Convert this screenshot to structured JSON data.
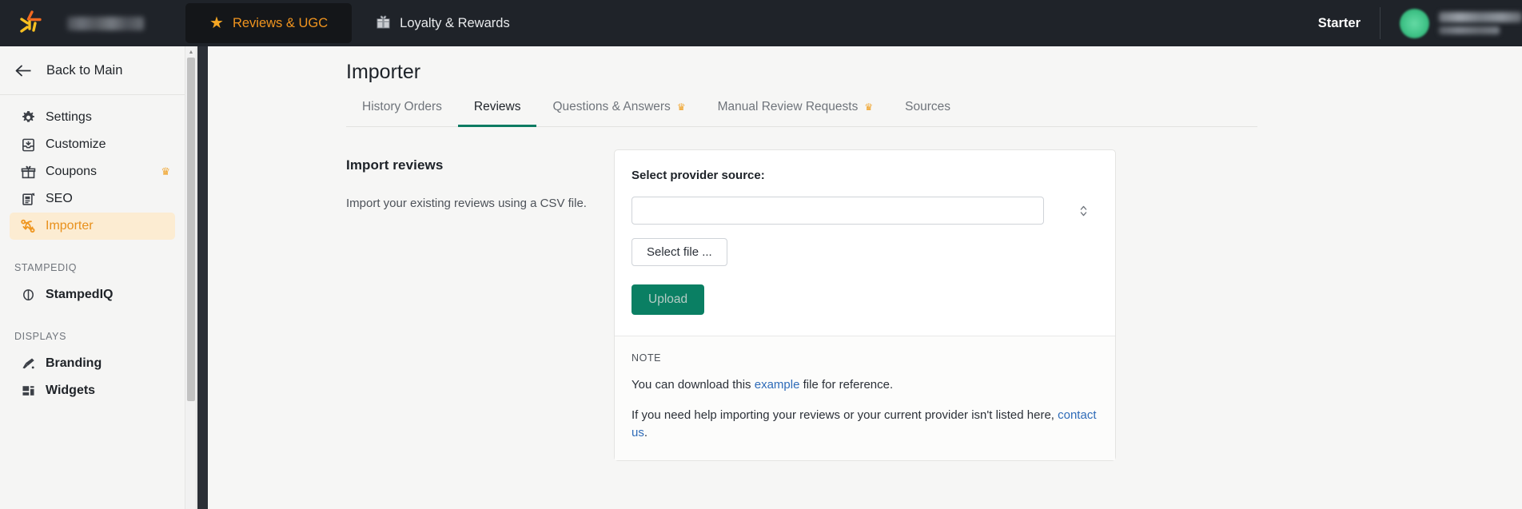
{
  "topbar": {
    "logo_icon": "starburst-logo-icon",
    "brand_name_redacted": "",
    "nav": [
      {
        "label": "Reviews & UGC",
        "icon": "star-icon",
        "icon_glyph": "★",
        "active": true
      },
      {
        "label": "Loyalty & Rewards",
        "icon": "gift-icon",
        "icon_glyph": "🎁",
        "active": false
      }
    ],
    "plan_badge": "Starter",
    "avatar_icon": "user-avatar",
    "accent_orange": "#f0941f",
    "bar_background": "#1f2329"
  },
  "sidebar": {
    "back": {
      "label": "Back to Main",
      "icon": "arrow-left-icon"
    },
    "items": [
      {
        "label": "Settings",
        "icon": "gear-icon",
        "active": false,
        "badge": ""
      },
      {
        "label": "Customize",
        "icon": "inbox-icon",
        "active": false,
        "badge": ""
      },
      {
        "label": "Coupons",
        "icon": "gift-icon",
        "active": false,
        "badge": "♛"
      },
      {
        "label": "SEO",
        "icon": "clipboard-icon",
        "active": false,
        "badge": ""
      },
      {
        "label": "Importer",
        "icon": "import-shuffle-icon",
        "active": true,
        "badge": ""
      }
    ],
    "groups": [
      {
        "title": "STAMPEDIQ",
        "items": [
          {
            "label": "StampedIQ",
            "icon": "brain-icon",
            "bold": true
          }
        ]
      },
      {
        "title": "DISPLAYS",
        "items": [
          {
            "label": "Branding",
            "icon": "paintbrush-icon",
            "bold": true
          },
          {
            "label": "Widgets",
            "icon": "widgets-layout-icon",
            "bold": true
          }
        ]
      }
    ],
    "active_background": "#fcecd2",
    "active_text": "#e8901b"
  },
  "main": {
    "page_title": "Importer",
    "tabs": [
      {
        "label": "History Orders",
        "active": false,
        "badge": ""
      },
      {
        "label": "Reviews",
        "active": true,
        "badge": ""
      },
      {
        "label": "Questions & Answers",
        "active": false,
        "badge": "♛"
      },
      {
        "label": "Manual Review Requests",
        "active": false,
        "badge": "♛"
      },
      {
        "label": "Sources",
        "active": false,
        "badge": ""
      }
    ],
    "active_tab_color": "#0c7b62",
    "left": {
      "heading": "Import reviews",
      "description": "Import your existing reviews using a CSV file."
    },
    "card": {
      "select_label": "Select provider source:",
      "select_value": "",
      "select_icon": "chevron-updown-icon",
      "select_file_label": "Select file ...",
      "upload_label": "Upload",
      "upload_color": "#0a7f63",
      "note": {
        "title": "NOTE",
        "line1_before": "You can download this ",
        "line1_link": "example",
        "line1_after": " file for reference.",
        "line2_before": "If you need help importing your reviews or your current provider isn't listed here, ",
        "line2_link": "contact us",
        "line2_after": ".",
        "link_color": "#2e6bb8"
      }
    }
  },
  "scrollbar": {
    "up_arrow": "▲",
    "down_arrow": "▼"
  }
}
